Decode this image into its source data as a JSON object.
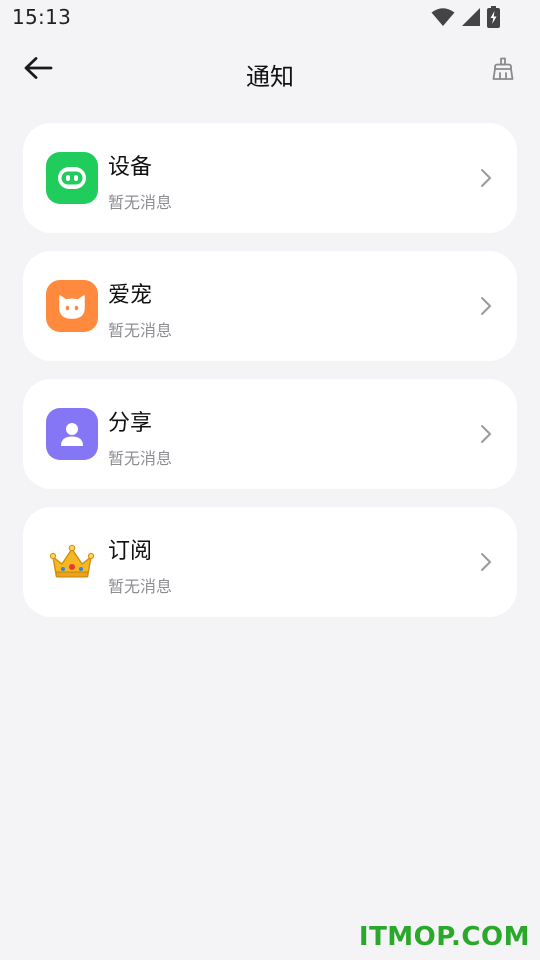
{
  "status_bar": {
    "time": "15:13"
  },
  "header": {
    "title": "通知",
    "back_icon": "arrow-left-icon",
    "clear_icon": "broom-clear-icon"
  },
  "notifications": [
    {
      "title": "设备",
      "subtitle": "暂无消息",
      "icon": "robot-icon",
      "color": "#1fcc5c"
    },
    {
      "title": "爱宠",
      "subtitle": "暂无消息",
      "icon": "cat-icon",
      "color": "#ff8a3d"
    },
    {
      "title": "分享",
      "subtitle": "暂无消息",
      "icon": "person-icon",
      "color": "#8476f5"
    },
    {
      "title": "订阅",
      "subtitle": "暂无消息",
      "icon": "crown-icon",
      "color": "#f2b21b"
    }
  ],
  "watermark": "ITMOP.COM"
}
